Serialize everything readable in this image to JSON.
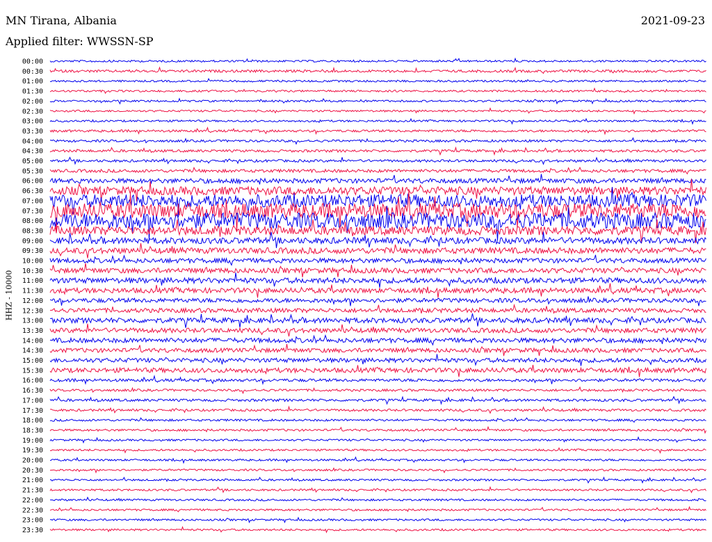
{
  "header": {
    "station": "MN Tirana, Albania",
    "date": "2021-09-23",
    "filter": "Applied filter: WWSSN-SP"
  },
  "chart_data": {
    "type": "line",
    "title": "MN Tirana, Albania",
    "ylabel": "HHZ - 10000",
    "row_labels": [
      "00:00",
      "00:30",
      "01:00",
      "01:30",
      "02:00",
      "02:30",
      "03:00",
      "03:30",
      "04:00",
      "04:30",
      "05:00",
      "05:30",
      "06:00",
      "06:30",
      "07:00",
      "07:30",
      "08:00",
      "08:30",
      "09:00",
      "09:30",
      "10:00",
      "10:30",
      "11:00",
      "11:30",
      "12:00",
      "12:30",
      "13:00",
      "13:30",
      "14:00",
      "14:30",
      "15:00",
      "15:30",
      "16:00",
      "16:30",
      "17:00",
      "17:30",
      "18:00",
      "18:30",
      "19:00",
      "19:30",
      "20:00",
      "20:30",
      "21:00",
      "21:30",
      "22:00",
      "22:30",
      "23:00",
      "23:30"
    ],
    "series_colors": [
      "#0000ee",
      "#ee1144"
    ],
    "relative_activity": [
      1,
      1.3,
      1,
      1,
      1,
      1,
      1,
      1.2,
      1.2,
      1.3,
      1.3,
      1.6,
      2.4,
      4.2,
      6.5,
      7.5,
      8,
      4.5,
      3.2,
      3,
      2.4,
      2.6,
      2.8,
      2.6,
      2.2,
      2.2,
      2.6,
      2.4,
      2.4,
      2.2,
      2.2,
      2.4,
      1.5,
      1.2,
      1.3,
      1.2,
      1.1,
      1.1,
      1,
      1,
      1,
      1,
      1,
      1,
      1,
      1,
      1,
      1
    ]
  }
}
